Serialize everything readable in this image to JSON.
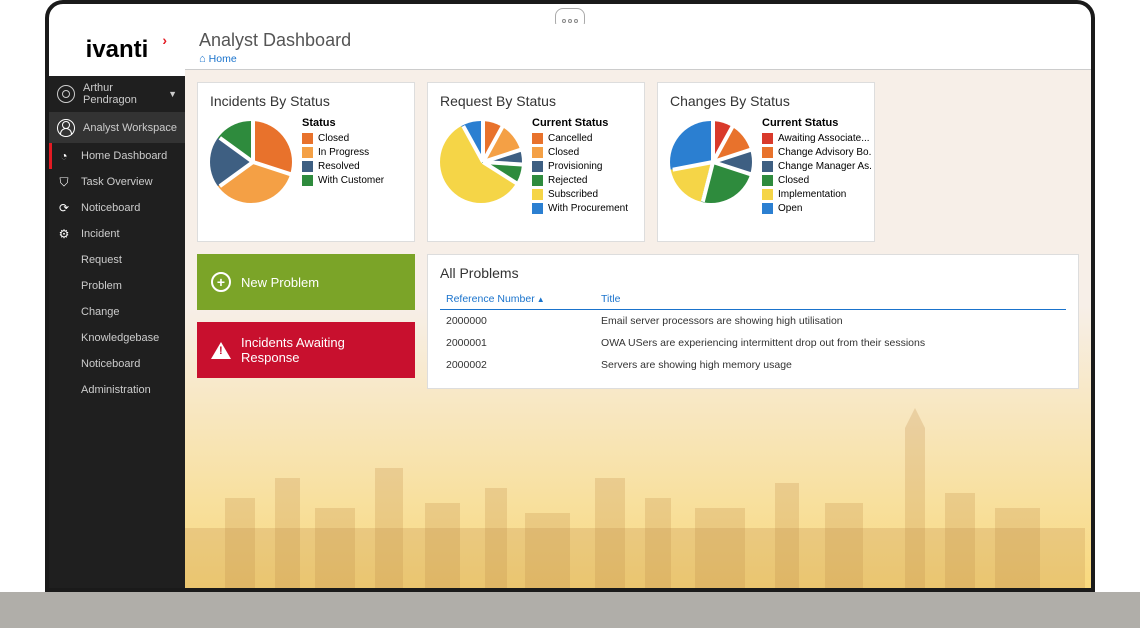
{
  "brand": "ivanti",
  "user": {
    "first": "Arthur",
    "last": "Pendragon"
  },
  "workspace_label": "Analyst Workspace",
  "nav": {
    "items": [
      {
        "label": "Home Dashboard",
        "icon": "dashboard-icon",
        "active": true
      },
      {
        "label": "Task Overview",
        "icon": "shield-icon"
      },
      {
        "label": "Noticeboard",
        "icon": "refresh-icon"
      },
      {
        "label": "Incident",
        "icon": "gear-icon"
      },
      {
        "label": "Request"
      },
      {
        "label": "Problem"
      },
      {
        "label": "Change"
      },
      {
        "label": "Knowledgebase"
      },
      {
        "label": "Noticeboard"
      },
      {
        "label": "Administration"
      }
    ]
  },
  "page_title": "Analyst Dashboard",
  "breadcrumb": {
    "home_icon": "home-icon",
    "home_label": "Home"
  },
  "actions": {
    "new_problem": "New Problem",
    "incidents_awaiting": "Incidents Awaiting Response"
  },
  "problems": {
    "title": "All Problems",
    "col_ref": "Reference Number",
    "col_title": "Title",
    "rows": [
      {
        "ref": "2000000",
        "title": "Email server processors are showing high utilisation"
      },
      {
        "ref": "2000001",
        "title": "OWA USers are experiencing intermittent drop out from their sessions"
      },
      {
        "ref": "2000002",
        "title": "Servers are showing high memory usage"
      }
    ]
  },
  "chart_data": [
    {
      "type": "pie",
      "title": "Incidents By Status",
      "legend_title": "Status",
      "series": [
        {
          "name": "Closed",
          "value": 30,
          "color": "#e8722c"
        },
        {
          "name": "In Progress",
          "value": 35,
          "color": "#f4a045"
        },
        {
          "name": "Resolved",
          "value": 20,
          "color": "#3e5f82"
        },
        {
          "name": "With Customer",
          "value": 15,
          "color": "#2e8b3d"
        }
      ]
    },
    {
      "type": "pie",
      "title": "Request By Status",
      "legend_title": "Current Status",
      "series": [
        {
          "name": "Cancelled",
          "value": 8,
          "color": "#e8722c"
        },
        {
          "name": "Closed",
          "value": 12,
          "color": "#f4a045"
        },
        {
          "name": "Provisioning",
          "value": 6,
          "color": "#3e5f82"
        },
        {
          "name": "Rejected",
          "value": 8,
          "color": "#2e8b3d"
        },
        {
          "name": "Subscribed",
          "value": 58,
          "color": "#f5d547"
        },
        {
          "name": "With Procurement",
          "value": 8,
          "color": "#2b7fd1"
        }
      ]
    },
    {
      "type": "pie",
      "title": "Changes By Status",
      "legend_title": "Current Status",
      "series": [
        {
          "name": "Awaiting Associate...",
          "value": 8,
          "color": "#d93a2b"
        },
        {
          "name": "Change Advisory Bo...",
          "value": 12,
          "color": "#e8722c"
        },
        {
          "name": "Change Manager As...",
          "value": 10,
          "color": "#3e5f82"
        },
        {
          "name": "Closed",
          "value": 24,
          "color": "#2e8b3d"
        },
        {
          "name": "Implementation",
          "value": 18,
          "color": "#f5d547"
        },
        {
          "name": "Open",
          "value": 28,
          "color": "#2b7fd1"
        }
      ]
    }
  ]
}
